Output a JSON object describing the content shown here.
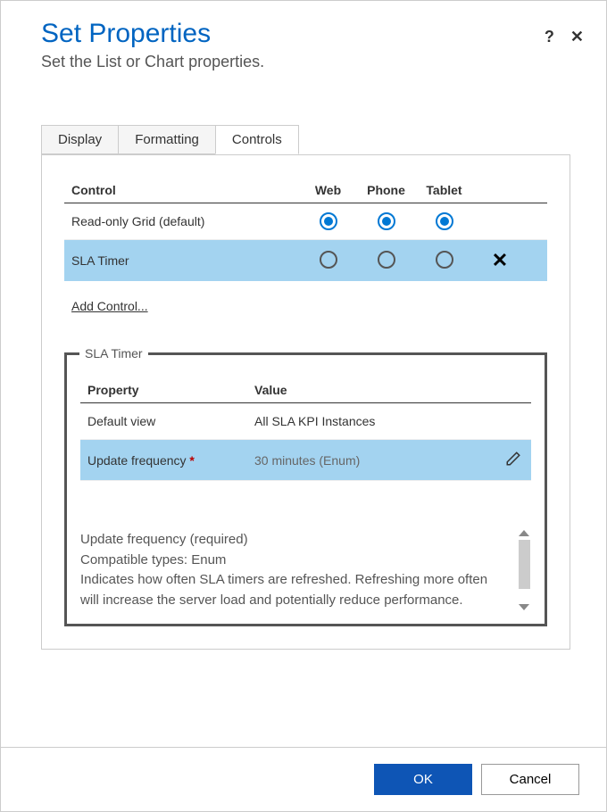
{
  "dialog": {
    "title": "Set Properties",
    "subtitle": "Set the List or Chart properties."
  },
  "tabs": {
    "display": "Display",
    "formatting": "Formatting",
    "controls": "Controls"
  },
  "controlsTable": {
    "headers": {
      "control": "Control",
      "web": "Web",
      "phone": "Phone",
      "tablet": "Tablet"
    },
    "rows": [
      {
        "name": "Read-only Grid (default)"
      },
      {
        "name": "SLA Timer"
      }
    ]
  },
  "addControlLabel": "Add Control...",
  "fieldset": {
    "legend": "SLA Timer",
    "headers": {
      "property": "Property",
      "value": "Value"
    },
    "rows": [
      {
        "property": "Default view",
        "value": "All SLA KPI Instances"
      },
      {
        "property": "Update frequency",
        "value": "30 minutes (Enum)"
      }
    ],
    "description": {
      "line1": "Update frequency (required)",
      "line2": "Compatible types: Enum",
      "line3": "Indicates how often SLA timers are refreshed. Refreshing more often will increase the server load and potentially reduce performance."
    }
  },
  "buttons": {
    "ok": "OK",
    "cancel": "Cancel"
  }
}
